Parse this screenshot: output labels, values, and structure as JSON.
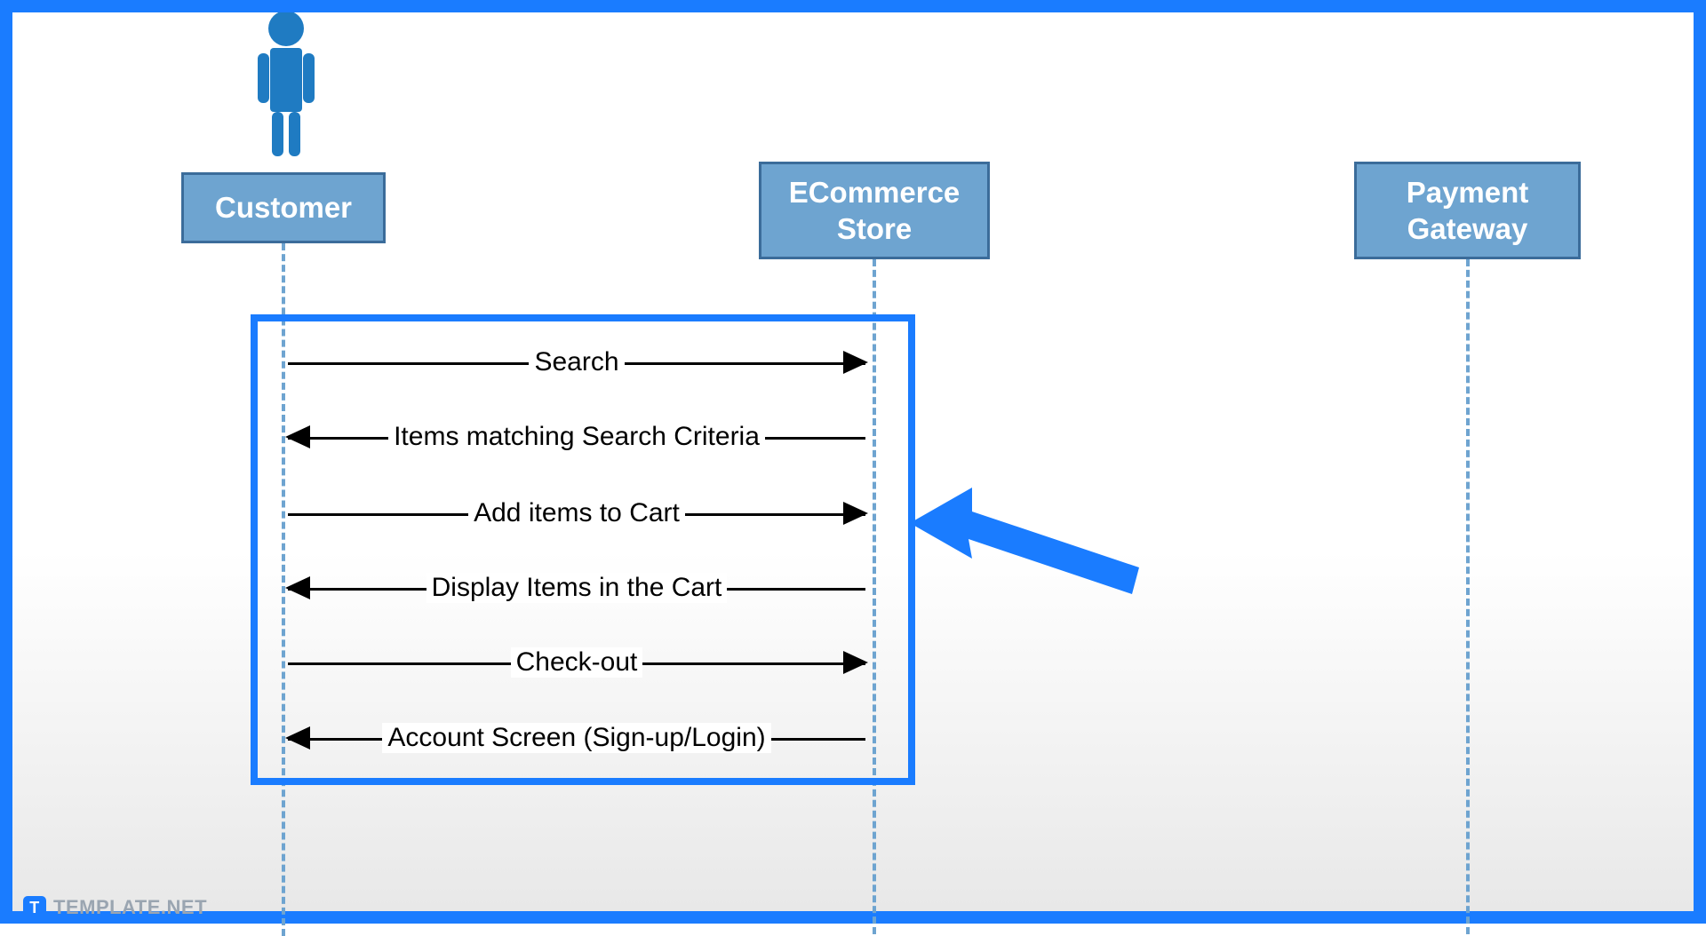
{
  "participants": {
    "customer": "Customer",
    "store_line1": "ECommerce",
    "store_line2": "Store",
    "gateway_line1": "Payment",
    "gateway_line2": "Gateway"
  },
  "messages": {
    "m1": "Search",
    "m2": "Items matching Search Criteria",
    "m3": "Add items to Cart",
    "m4": "Display Items in the Cart",
    "m5": "Check-out",
    "m6": "Account Screen (Sign-up/Login)"
  },
  "watermark": {
    "icon_letter": "T",
    "text": "TEMPLATE.NET"
  },
  "colors": {
    "frame": "#1a7cff",
    "participant_fill": "#6ea4d0",
    "participant_border": "#3b6c9a"
  },
  "diagram": {
    "type": "sequence",
    "actors": [
      "Customer",
      "ECommerce Store",
      "Payment Gateway"
    ],
    "sequence": [
      {
        "from": "Customer",
        "to": "ECommerce Store",
        "label": "Search"
      },
      {
        "from": "ECommerce Store",
        "to": "Customer",
        "label": "Items matching Search Criteria"
      },
      {
        "from": "Customer",
        "to": "ECommerce Store",
        "label": "Add items to Cart"
      },
      {
        "from": "ECommerce Store",
        "to": "Customer",
        "label": "Display Items in the Cart"
      },
      {
        "from": "Customer",
        "to": "ECommerce Store",
        "label": "Check-out"
      },
      {
        "from": "ECommerce Store",
        "to": "Customer",
        "label": "Account Screen (Sign-up/Login)"
      }
    ],
    "highlighted_region": "messages between Customer and ECommerce Store"
  }
}
